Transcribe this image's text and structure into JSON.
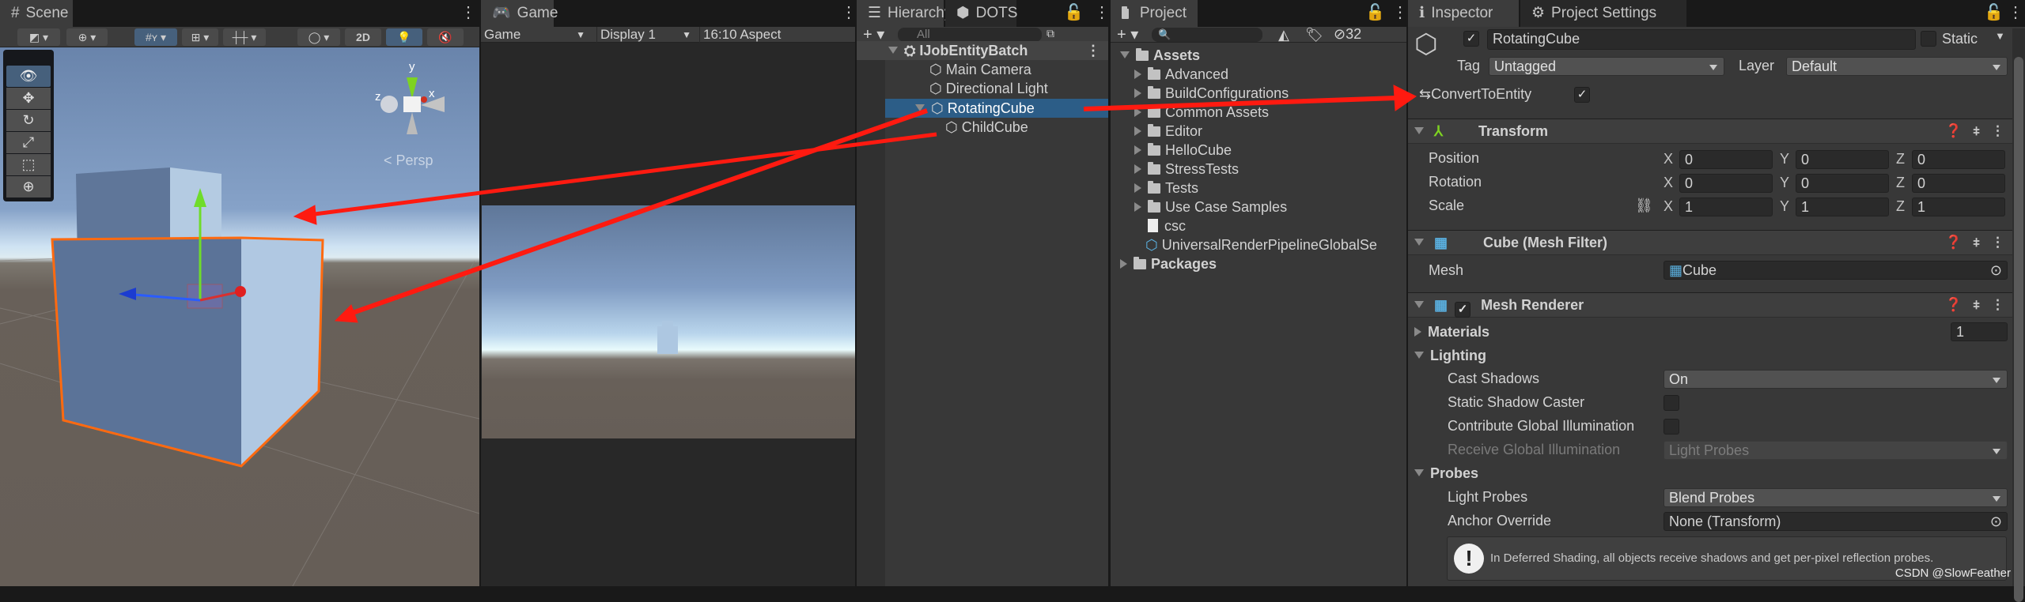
{
  "scene": {
    "tab": "Scene",
    "toolbar": {
      "mode_2d": "2D"
    },
    "tools": [
      "view-tool",
      "move-tool",
      "rotate-tool",
      "scale-tool",
      "rect-tool",
      "transform-tool"
    ],
    "gizmo": {
      "y": "y",
      "x": "x",
      "z": "z",
      "projection": "Persp"
    }
  },
  "game": {
    "tab": "Game",
    "view_select": "Game",
    "display": "Display 1",
    "aspect": "16:10 Aspect"
  },
  "hierarchy": {
    "tab": "Hierarchy",
    "tab2": "DOTS",
    "search_placeholder": "All",
    "scene_name": "IJobEntityBatch",
    "items": [
      {
        "label": "Main Camera"
      },
      {
        "label": "Directional Light"
      },
      {
        "label": "RotatingCube",
        "selected": true
      },
      {
        "label": "ChildCube"
      }
    ]
  },
  "project": {
    "tab": "Project",
    "hidden_count": "32",
    "root": "Assets",
    "folders": [
      "Advanced",
      "BuildConfigurations",
      "Common Assets",
      "Editor",
      "HelloCube",
      "StressTests",
      "Tests",
      "Use Case Samples"
    ],
    "files": [
      "csc",
      "UniversalRenderPipelineGlobalSe"
    ],
    "packages": "Packages"
  },
  "inspector": {
    "tab": "Inspector",
    "tab2": "Project Settings",
    "object_name": "RotatingCube",
    "static_label": "Static",
    "tag_label": "Tag",
    "tag_value": "Untagged",
    "layer_label": "Layer",
    "layer_value": "Default",
    "convert_label": "ConvertToEntity",
    "transform": {
      "title": "Transform",
      "position_label": "Position",
      "position": [
        "0",
        "0",
        "0"
      ],
      "rotation_label": "Rotation",
      "rotation": [
        "0",
        "0",
        "0"
      ],
      "scale_label": "Scale",
      "scale": [
        "1",
        "1",
        "1"
      ],
      "axes": [
        "X",
        "Y",
        "Z"
      ]
    },
    "mesh_filter": {
      "title": "Cube (Mesh Filter)",
      "mesh_label": "Mesh",
      "mesh_value": "Cube"
    },
    "mesh_renderer": {
      "title": "Mesh Renderer",
      "materials_label": "Materials",
      "materials_count": "1",
      "lighting_label": "Lighting",
      "cast_shadows_label": "Cast Shadows",
      "cast_shadows_value": "On",
      "static_shadow_label": "Static Shadow Caster",
      "contribute_gi_label": "Contribute Global Illumination",
      "receive_gi_label": "Receive Global Illumination",
      "receive_gi_value": "Light Probes",
      "probes_label": "Probes",
      "light_probes_label": "Light Probes",
      "light_probes_value": "Blend Probes",
      "anchor_label": "Anchor Override",
      "anchor_value": "None (Transform)",
      "help_text": "In Deferred Shading, all objects receive shadows and get per-pixel reflection probes."
    }
  },
  "watermark": "CSDN @SlowFeather",
  "colors": {
    "selection": "#2c5d87",
    "annotation_arrow": "#ff1a10",
    "outline": "#ff6a10"
  }
}
